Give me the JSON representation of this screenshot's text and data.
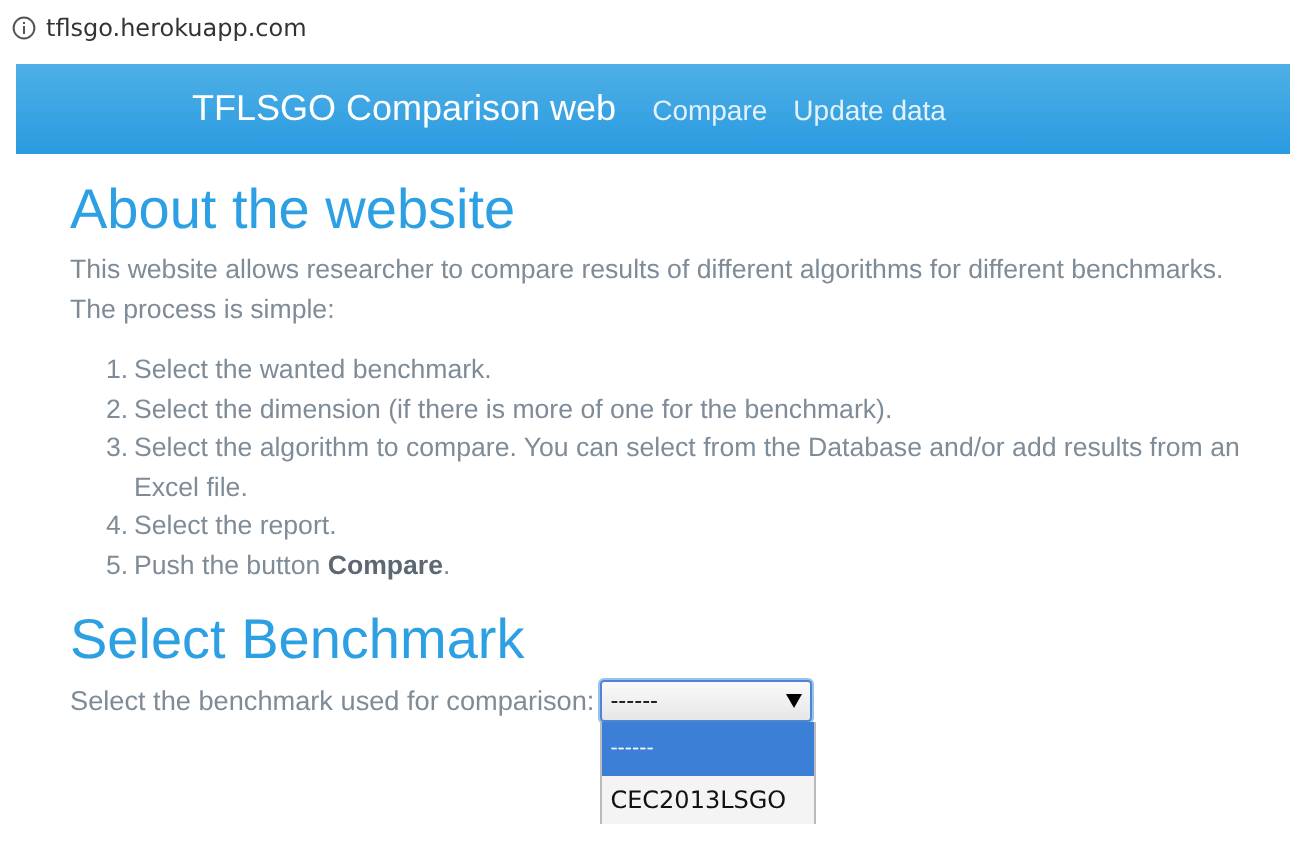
{
  "address_bar": {
    "url": "tflsgo.herokuapp.com"
  },
  "navbar": {
    "brand": "TFLSGO Comparison web",
    "links": [
      {
        "label": "Compare"
      },
      {
        "label": "Update data"
      }
    ]
  },
  "about": {
    "heading": "About the website",
    "intro": "This website allows researcher to compare results of different algorithms for different benchmarks. The process is simple:",
    "steps": [
      {
        "number": "1.",
        "text": "Select the wanted benchmark."
      },
      {
        "number": "2.",
        "text": "Select the dimension (if there is more of one for the benchmark)."
      },
      {
        "number": "3.",
        "text": "Select the algorithm to compare. You can select from the Database and/or add results from an Excel file."
      },
      {
        "number": "4.",
        "text": "Select the report."
      },
      {
        "number": "5.",
        "text": "Push the button **Compare**."
      }
    ]
  },
  "select_benchmark": {
    "heading": "Select Benchmark",
    "label": "Select the benchmark used for comparison:",
    "dropdown": {
      "value": "------",
      "expanded": true,
      "options": [
        {
          "label": "------",
          "selected": true
        },
        {
          "label": "CEC2013LSGO",
          "selected": false
        }
      ]
    }
  }
}
